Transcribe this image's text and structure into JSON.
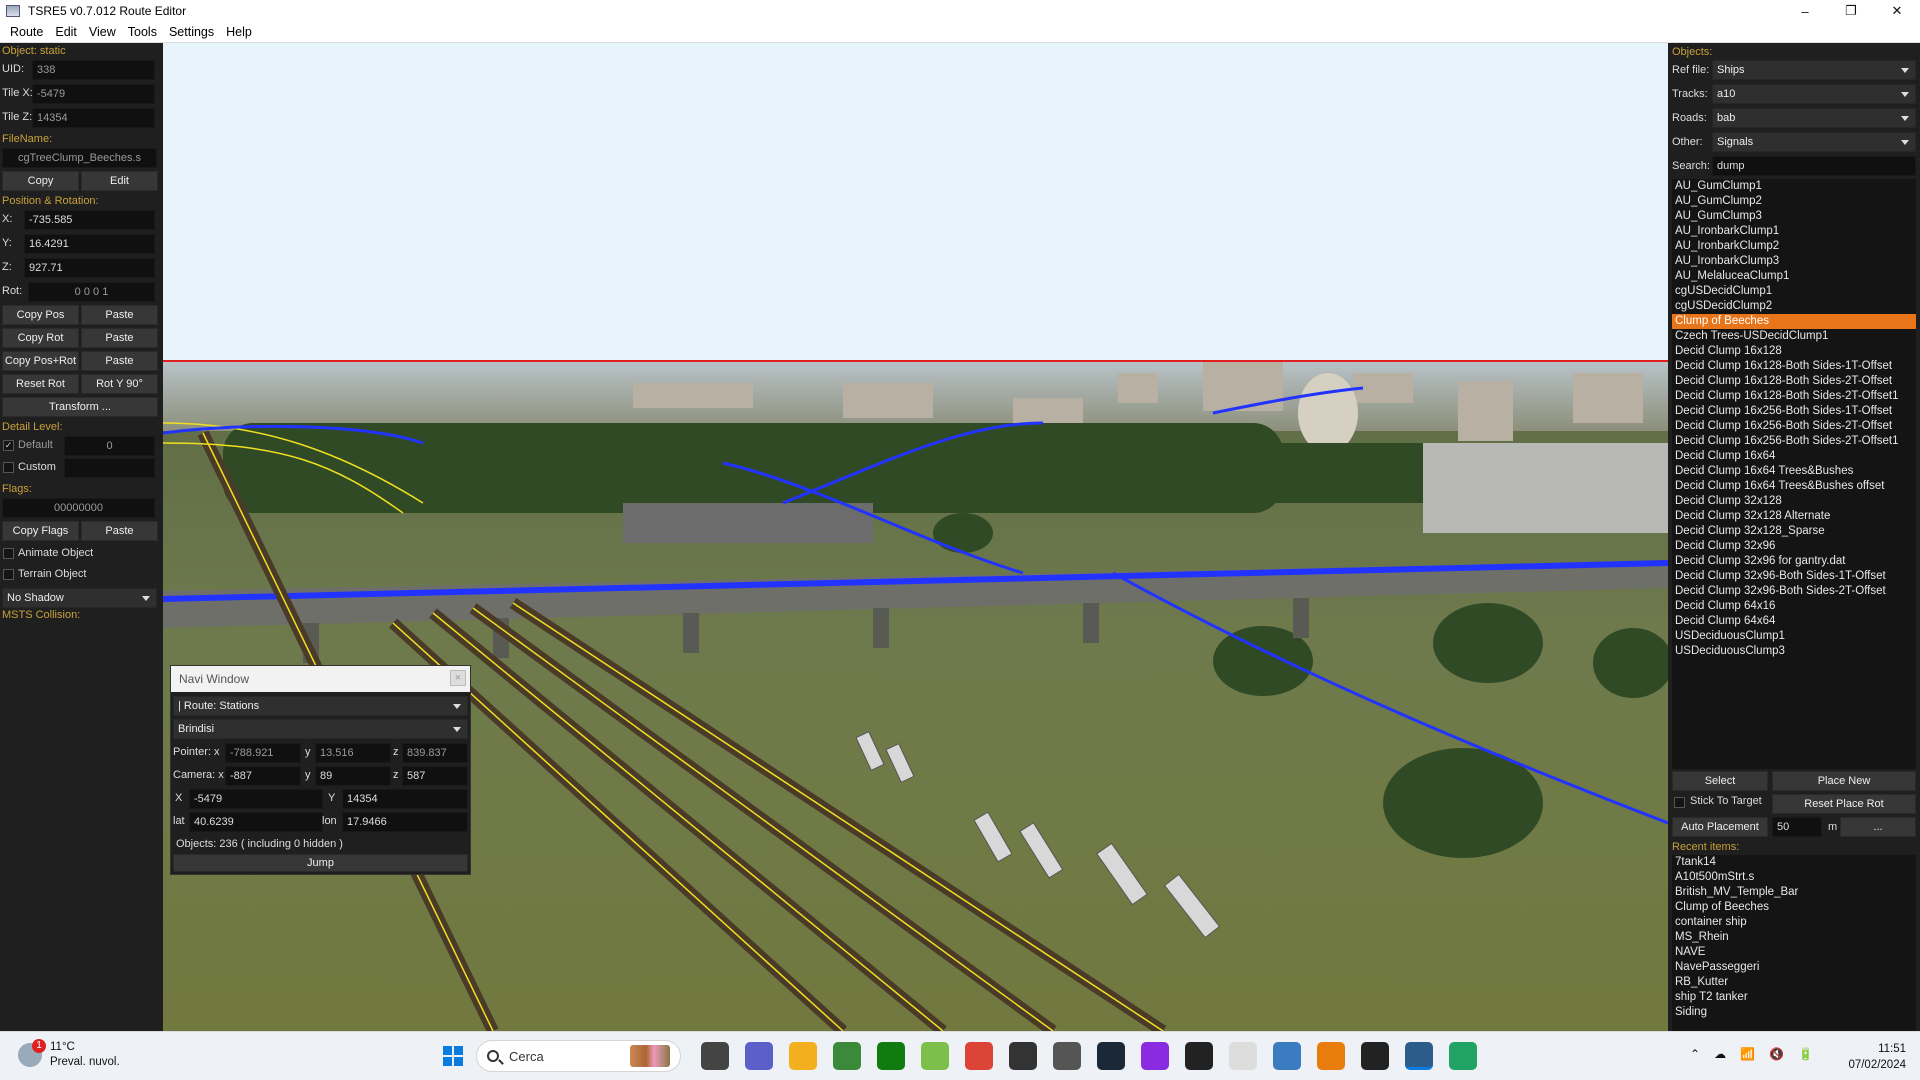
{
  "window": {
    "title": "TSRE5 v0.7.012 Route Editor",
    "minimize": "–",
    "maximize": "❐",
    "close": "✕"
  },
  "menu": [
    "Route",
    "Edit",
    "View",
    "Tools",
    "Settings",
    "Help"
  ],
  "left": {
    "object_header": "Object: static",
    "uid_label": "UID:",
    "uid": "338",
    "tilex_label": "Tile X:",
    "tilex": "-5479",
    "tilez_label": "Tile Z:",
    "tilez": "14354",
    "filename_header": "FileName:",
    "filename": "cgTreeClump_Beeches.s",
    "copy": "Copy",
    "edit": "Edit",
    "posrot_header": "Position & Rotation:",
    "x_label": "X:",
    "x": "-735.585",
    "y_label": "Y:",
    "y": "16.4291",
    "z_label": "Z:",
    "z": "927.71",
    "rot_label": "Rot:",
    "rot": "0 0 0 1",
    "copy_pos": "Copy Pos",
    "paste1": "Paste",
    "copy_rot": "Copy Rot",
    "paste2": "Paste",
    "copy_posrot": "Copy Pos+Rot",
    "paste3": "Paste",
    "reset_rot": "Reset Rot",
    "rot_y": "Rot Y 90°",
    "transform": "Transform ...",
    "detail_header": "Detail Level:",
    "default_label": "Default",
    "default_value": "0",
    "custom_label": "Custom",
    "flags_header": "Flags:",
    "flags": "00000000",
    "copy_flags": "Copy Flags",
    "paste4": "Paste",
    "animate": "Animate Object",
    "terrain": "Terrain Object",
    "shadow": "No Shadow",
    "msts_header": "MSTS Collision:"
  },
  "navi": {
    "title": "Navi Window",
    "route_select": "| Route: Stations",
    "station_select": "Brindisi",
    "pointer_label": "Pointer: x",
    "pointer_x": "-788.921",
    "pointer_y_label": "y",
    "pointer_y": "13.516",
    "pointer_z_label": "z",
    "pointer_z": "839.837",
    "camera_label": "Camera: x",
    "camera_x": "-887",
    "camera_y_label": "y",
    "camera_y": "89",
    "camera_z_label": "z",
    "camera_z": "587",
    "tx_label": "X",
    "tx": "-5479",
    "ty_label": "Y",
    "ty": "14354",
    "lat_label": "lat",
    "lat": "40.6239",
    "lon_label": "lon",
    "lon": "17.9466",
    "objects": "Objects: 236 ( including 0 hidden )",
    "jump": "Jump"
  },
  "right": {
    "header": "Objects:",
    "ref_label": "Ref file:",
    "ref": "Ships",
    "tracks_label": "Tracks:",
    "tracks": "a10",
    "roads_label": "Roads:",
    "roads": "bab",
    "other_label": "Other:",
    "other": "Signals",
    "search_label": "Search:",
    "search": "dump",
    "selected_index": 9,
    "items": [
      "AU_GumClump1",
      "AU_GumClump2",
      "AU_GumClump3",
      "AU_IronbarkClump1",
      "AU_IronbarkClump2",
      "AU_IronbarkClump3",
      "AU_MelaluceaClump1",
      "cgUSDecidClump1",
      "cgUSDecidClump2",
      "Clump of Beeches",
      "Czech Trees-USDecidClump1",
      "Decid Clump 16x128",
      "Decid Clump 16x128-Both Sides-1T-Offset",
      "Decid Clump 16x128-Both Sides-2T-Offset",
      "Decid Clump 16x128-Both Sides-2T-Offset1",
      "Decid Clump 16x256-Both Sides-1T-Offset",
      "Decid Clump 16x256-Both Sides-2T-Offset",
      "Decid Clump 16x256-Both Sides-2T-Offset1",
      "Decid Clump 16x64",
      "Decid Clump 16x64 Trees&Bushes",
      "Decid Clump 16x64 Trees&Bushes offset",
      "Decid Clump 32x128",
      "Decid Clump 32x128 Alternate",
      "Decid Clump 32x128_Sparse",
      "Decid Clump 32x96",
      "Decid Clump 32x96 for gantry.dat",
      "Decid Clump 32x96-Both Sides-1T-Offset",
      "Decid Clump 32x96-Both Sides-2T-Offset",
      "Decid Clump 64x16",
      "Decid Clump 64x64",
      "USDeciduousClump1",
      "USDeciduousClump3"
    ],
    "select": "Select",
    "place_new": "Place New",
    "stick": "Stick To Target",
    "reset_place_rot": "Reset Place Rot",
    "auto_placement": "Auto Placement",
    "auto_value": "50",
    "auto_unit": "m",
    "more": "...",
    "recent_header": "Recent items:",
    "recent": [
      "7tank14",
      "A10t500mStrt.s",
      "British_MV_Temple_Bar",
      "Clump of Beeches",
      "container ship",
      "MS_Rhein",
      "NAVE",
      "NavePasseggeri",
      "RB_Kutter",
      "ship T2 tanker",
      "Siding"
    ]
  },
  "taskbar": {
    "weather_badge": "1",
    "temp": "11°C",
    "weather": "Preval. nuvol.",
    "search": "Cerca",
    "time": "11:51",
    "date": "07/02/2024",
    "icons": [
      "file-explorer-icon",
      "teams-icon",
      "folder-icon",
      "notepad-icon",
      "xbox-icon",
      "app-green-icon",
      "chrome-icon",
      "chat-icon",
      "calculator-icon",
      "steam-icon",
      "app-purple-icon",
      "epic-games-icon",
      "document-icon",
      "chart-app-icon",
      "blender-icon",
      "terminal-icon",
      "route-editor-icon",
      "spreadsheet-icon"
    ],
    "icon_colors": [
      "#444",
      "#5b5fc7",
      "#f2b01e",
      "#3a8a3a",
      "#107c10",
      "#7cc04b",
      "#db4437",
      "#333",
      "#555",
      "#1b2838",
      "#8a2be2",
      "#222",
      "#ddd",
      "#3b7bbf",
      "#e87d0d",
      "#222",
      "#2b5c8a",
      "#21a366"
    ]
  }
}
